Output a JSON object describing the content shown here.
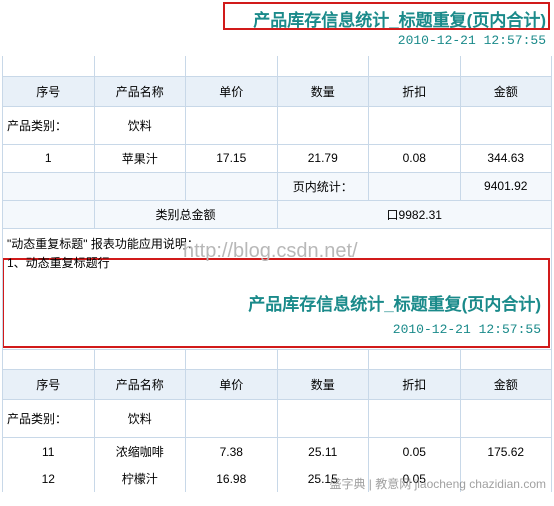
{
  "report1": {
    "title": "产品库存信息统计_标题重复(页内合计)",
    "timestamp": "2010-12-21 12:57:55",
    "headers": [
      "序号",
      "产品名称",
      "单价",
      "数量",
      "折扣",
      "金额"
    ],
    "category_label": "产品类别：",
    "category_value": "饮料",
    "rows": [
      {
        "no": "1",
        "name": "苹果汁",
        "price": "17.15",
        "qty": "21.79",
        "disc": "0.08",
        "amt": "344.63"
      }
    ],
    "pagesum_label": "页内统计：",
    "pagesum_amt": "9401.92",
    "cattotal_label": "类别总金额",
    "cattotal_val": "口9982.31"
  },
  "note": {
    "line1": "\"动态重复标题\" 报表功能应用说明：",
    "line2": "1、动态重复标题行",
    "watermark": "http://blog.csdn.net/"
  },
  "report2": {
    "title": "产品库存信息统计_标题重复(页内合计)",
    "timestamp": "2010-12-21 12:57:55",
    "headers": [
      "序号",
      "产品名称",
      "单价",
      "数量",
      "折扣",
      "金额"
    ],
    "category_label": "产品类别：",
    "category_value": "饮料",
    "rows": [
      {
        "no": "11",
        "name": "浓缩咖啡",
        "price": "7.38",
        "qty": "25.11",
        "disc": "0.05",
        "amt": "175.62"
      },
      {
        "no": "12",
        "name": "柠檬汁",
        "price": "16.98",
        "qty": "25.15",
        "disc": "0.05",
        "amt": ""
      }
    ]
  },
  "footer_wm": "盛字典 | 教意网 jiaocheng chazidian.com"
}
